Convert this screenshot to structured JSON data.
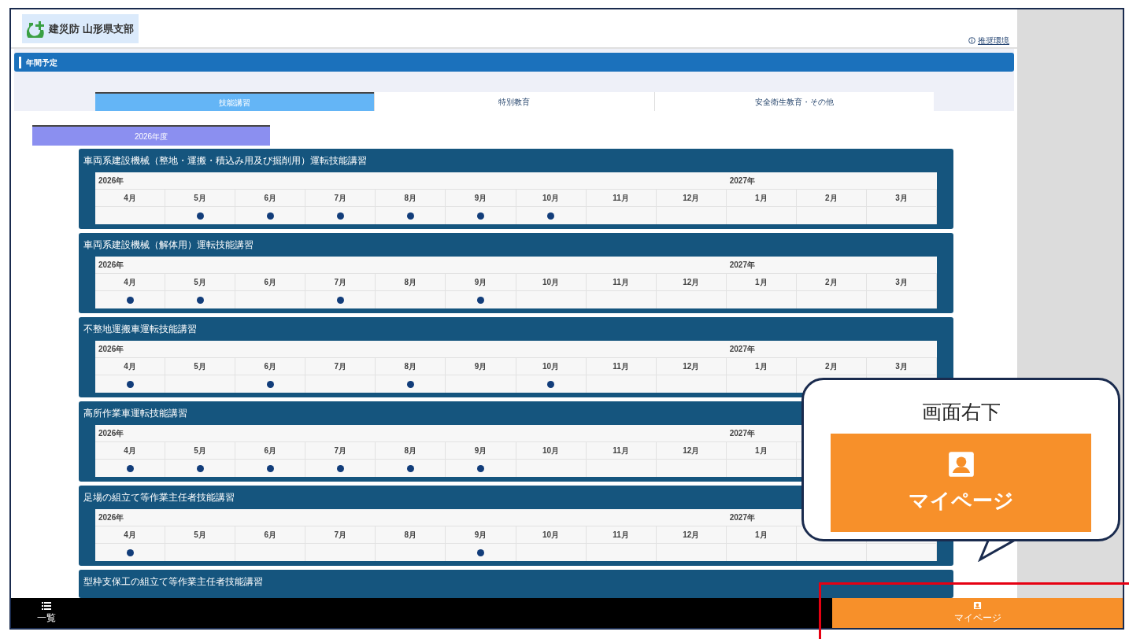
{
  "header": {
    "logo_text": "建災防 山形県支部",
    "link": "推奨環境"
  },
  "section_title": "年間予定",
  "tabs": [
    {
      "label": "技能講習",
      "selected": true
    },
    {
      "label": "特別教育",
      "selected": false
    },
    {
      "label": "安全衛生教育・その他",
      "selected": false
    }
  ],
  "year_tabs": [
    {
      "label": "2026年度",
      "selected": true
    }
  ],
  "courses": [
    {
      "title": "車両系建設機械（整地・運搬・積込み用及び掘削用）運転技能講習",
      "year_start": "2026年",
      "year_next": "2027年",
      "months": [
        {
          "label": "4月",
          "scheduled": false
        },
        {
          "label": "5月",
          "scheduled": true
        },
        {
          "label": "6月",
          "scheduled": true
        },
        {
          "label": "7月",
          "scheduled": true
        },
        {
          "label": "8月",
          "scheduled": true
        },
        {
          "label": "9月",
          "scheduled": true
        },
        {
          "label": "10月",
          "scheduled": true
        },
        {
          "label": "11月",
          "scheduled": false
        },
        {
          "label": "12月",
          "scheduled": false
        },
        {
          "label": "1月",
          "scheduled": false
        },
        {
          "label": "2月",
          "scheduled": false
        },
        {
          "label": "3月",
          "scheduled": false
        }
      ]
    },
    {
      "title": "車両系建設機械（解体用）運転技能講習",
      "year_start": "2026年",
      "year_next": "2027年",
      "months": [
        {
          "label": "4月",
          "scheduled": true
        },
        {
          "label": "5月",
          "scheduled": true
        },
        {
          "label": "6月",
          "scheduled": false
        },
        {
          "label": "7月",
          "scheduled": true
        },
        {
          "label": "8月",
          "scheduled": false
        },
        {
          "label": "9月",
          "scheduled": true
        },
        {
          "label": "10月",
          "scheduled": false
        },
        {
          "label": "11月",
          "scheduled": false
        },
        {
          "label": "12月",
          "scheduled": false
        },
        {
          "label": "1月",
          "scheduled": false
        },
        {
          "label": "2月",
          "scheduled": false
        },
        {
          "label": "3月",
          "scheduled": false
        }
      ]
    },
    {
      "title": "不整地運搬車運転技能講習",
      "year_start": "2026年",
      "year_next": "2027年",
      "months": [
        {
          "label": "4月",
          "scheduled": true
        },
        {
          "label": "5月",
          "scheduled": false
        },
        {
          "label": "6月",
          "scheduled": true
        },
        {
          "label": "7月",
          "scheduled": false
        },
        {
          "label": "8月",
          "scheduled": true
        },
        {
          "label": "9月",
          "scheduled": false
        },
        {
          "label": "10月",
          "scheduled": true
        },
        {
          "label": "11月",
          "scheduled": false
        },
        {
          "label": "12月",
          "scheduled": false
        },
        {
          "label": "1月",
          "scheduled": false
        },
        {
          "label": "2月"
        },
        {
          "label": "3月"
        }
      ]
    },
    {
      "title": "高所作業車運転技能講習",
      "year_start": "2026年",
      "year_next": "2027年",
      "months": [
        {
          "label": "4月",
          "scheduled": true
        },
        {
          "label": "5月",
          "scheduled": true
        },
        {
          "label": "6月",
          "scheduled": true
        },
        {
          "label": "7月",
          "scheduled": true
        },
        {
          "label": "8月",
          "scheduled": true
        },
        {
          "label": "9月",
          "scheduled": true
        },
        {
          "label": "10月",
          "scheduled": false
        },
        {
          "label": "11月",
          "scheduled": false
        },
        {
          "label": "12月",
          "scheduled": false
        },
        {
          "label": "1月",
          "scheduled": false
        }
      ]
    },
    {
      "title": "足場の組立て等作業主任者技能講習",
      "year_start": "2026年",
      "year_next": "2027年",
      "months": [
        {
          "label": "4月",
          "scheduled": true
        },
        {
          "label": "5月",
          "scheduled": false
        },
        {
          "label": "6月",
          "scheduled": false
        },
        {
          "label": "7月",
          "scheduled": false
        },
        {
          "label": "8月",
          "scheduled": false
        },
        {
          "label": "9月",
          "scheduled": true
        },
        {
          "label": "10月",
          "scheduled": false
        },
        {
          "label": "11月",
          "scheduled": false
        },
        {
          "label": "12月",
          "scheduled": false
        },
        {
          "label": "1月",
          "scheduled": false
        }
      ]
    },
    {
      "title": "型枠支保工の組立て等作業主任者技能講習"
    }
  ],
  "bottom_nav": [
    {
      "label": "一覧",
      "selected": false
    },
    {
      "label": "マイページ",
      "selected": true
    }
  ],
  "callout": {
    "caption": "画面右下",
    "button_label": "マイページ"
  }
}
